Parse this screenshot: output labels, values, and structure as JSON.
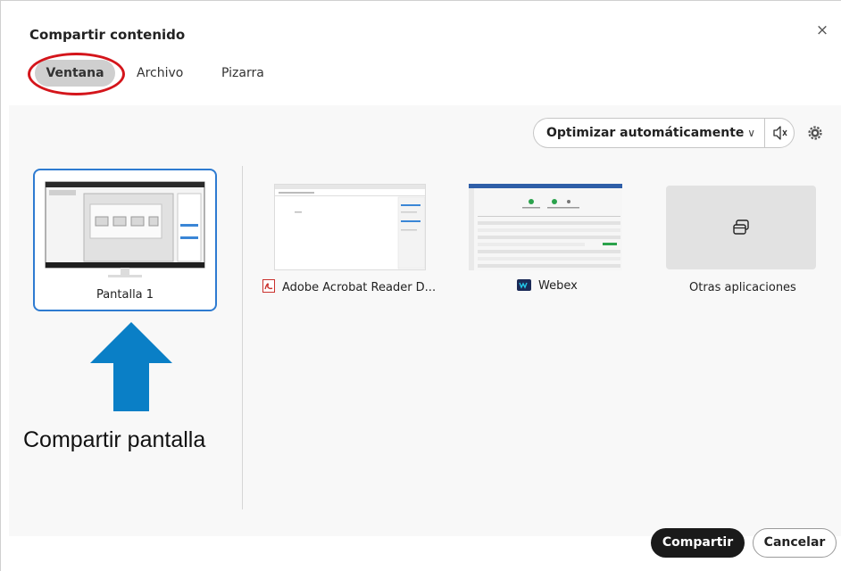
{
  "dialog": {
    "title": "Compartir contenido",
    "close_glyph": "×"
  },
  "tabs": [
    {
      "label": "Ventana",
      "selected": true
    },
    {
      "label": "Archivo",
      "selected": false
    },
    {
      "label": "Pizarra",
      "selected": false
    }
  ],
  "toolbar": {
    "optimize_label": "Optimizar automáticamente",
    "optimize_chevron": "∨",
    "audio_icon": "speaker-muted-icon",
    "settings_icon": "gear-icon"
  },
  "screens": [
    {
      "label": "Pantalla 1",
      "selected": true
    }
  ],
  "apps": [
    {
      "label": "Adobe Acrobat Reader D...",
      "icon": "adobe-acrobat-icon"
    },
    {
      "label": "Webex",
      "icon": "webex-icon"
    },
    {
      "label": "Otras aplicaciones",
      "icon": "windows-stack-icon"
    }
  ],
  "annotation": {
    "text": "Compartir pantalla",
    "arrow_color": "#0a7fc6",
    "ring_color": "#d4151b"
  },
  "footer": {
    "share_label": "Compartir",
    "cancel_label": "Cancelar"
  },
  "colors": {
    "selection_border": "#2e7bd1",
    "primary_button": "#1a1a1a"
  }
}
